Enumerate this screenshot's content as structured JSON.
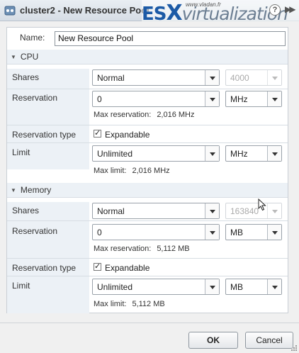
{
  "window": {
    "title": "cluster2 - New Resource Pool",
    "watermark_url": "www.vladan.fr",
    "watermark_es": "ES",
    "watermark_x": "X",
    "watermark_virt": "virtualization",
    "help_glyph": "?",
    "expand_glyph": "▶▶"
  },
  "form": {
    "name_label": "Name:",
    "name_value": "New Resource Pool",
    "cpu": {
      "section_label": "CPU",
      "shares_label": "Shares",
      "shares_value": "Normal",
      "shares_number": "4000",
      "reservation_label": "Reservation",
      "reservation_value": "0",
      "reservation_unit": "MHz",
      "max_reservation_label": "Max reservation:",
      "max_reservation_value": "2,016 MHz",
      "reservation_type_label": "Reservation type",
      "expandable_label": "Expandable",
      "expandable_checked": true,
      "limit_label": "Limit",
      "limit_value": "Unlimited",
      "limit_unit": "MHz",
      "max_limit_label": "Max limit:",
      "max_limit_value": "2,016 MHz"
    },
    "memory": {
      "section_label": "Memory",
      "shares_label": "Shares",
      "shares_value": "Normal",
      "shares_number": "163840",
      "reservation_label": "Reservation",
      "reservation_value": "0",
      "reservation_unit": "MB",
      "max_reservation_label": "Max reservation:",
      "max_reservation_value": "5,112 MB",
      "reservation_type_label": "Reservation type",
      "expandable_label": "Expandable",
      "expandable_checked": true,
      "limit_label": "Limit",
      "limit_value": "Unlimited",
      "limit_unit": "MB",
      "max_limit_label": "Max limit:",
      "max_limit_value": "5,112 MB"
    }
  },
  "buttons": {
    "ok": "OK",
    "cancel": "Cancel"
  },
  "icons": {
    "title": "resource-pool-icon",
    "help": "help-icon",
    "expand": "expand-icon",
    "collapse": "collapse-triangle-icon",
    "check": "checkmark-icon",
    "cursor": "mouse-pointer-icon"
  },
  "colors": {
    "label_column": "#ecf1f6",
    "title_bar": "#dde3ea",
    "watermark_blue": "#1c5aa6",
    "border": "#c9cfd5"
  }
}
